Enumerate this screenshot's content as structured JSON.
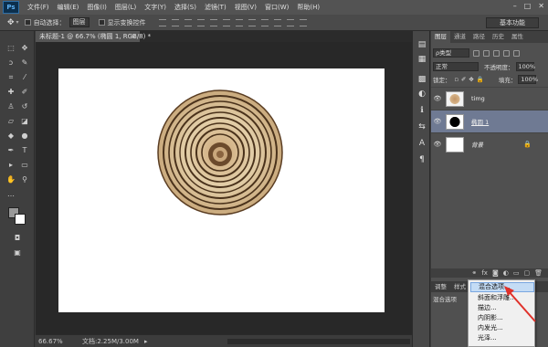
{
  "app": {
    "logo": "Ps"
  },
  "menubar": {
    "items": [
      "文件(F)",
      "编辑(E)",
      "图像(I)",
      "图层(L)",
      "文字(Y)",
      "选择(S)",
      "滤镜(T)",
      "视图(V)",
      "窗口(W)",
      "帮助(H)"
    ],
    "window_controls": [
      "–",
      "□",
      "✕"
    ]
  },
  "options_bar": {
    "auto_select_label": "自动选择：",
    "auto_select_value": "图层",
    "show_transform_label": "显示变换控件",
    "workspace": "基本功能"
  },
  "document": {
    "tab_title": "未标题-1 @ 66.7% (椭圆 1, RGB/8) *",
    "zoom": "66.67%",
    "doc_info": "文档:2.25M/3.00M"
  },
  "layers_panel": {
    "tabs": [
      "图层",
      "通道",
      "路径",
      "历史",
      "属性"
    ],
    "filter_type": "ρ类型",
    "blend_mode": "正常",
    "opacity_label": "不透明度：",
    "opacity": "100%",
    "lock_label": "锁定：",
    "fill_label": "填充：",
    "fill": "100%",
    "layers": [
      {
        "name": "timg",
        "visible": true,
        "selected": false,
        "thumb": "wood"
      },
      {
        "name": "椭圆 1",
        "visible": true,
        "selected": true,
        "thumb": "ellipse"
      },
      {
        "name": "背景",
        "visible": true,
        "selected": false,
        "thumb": "white",
        "locked": true
      }
    ],
    "bottom_icons": [
      "fx"
    ]
  },
  "lower_panel": {
    "tabs": [
      "调整",
      "样式"
    ],
    "visible_text": "混合选项"
  },
  "context_menu": {
    "items": [
      "混合选项...",
      "斜面和浮雕...",
      "描边...",
      "内阴影...",
      "内发光...",
      "光泽..."
    ],
    "highlighted_index": 0
  },
  "colors": {
    "highlight": "#c4dcf5",
    "selected_layer": "#6f7a93",
    "arrow": "#e0312a"
  }
}
